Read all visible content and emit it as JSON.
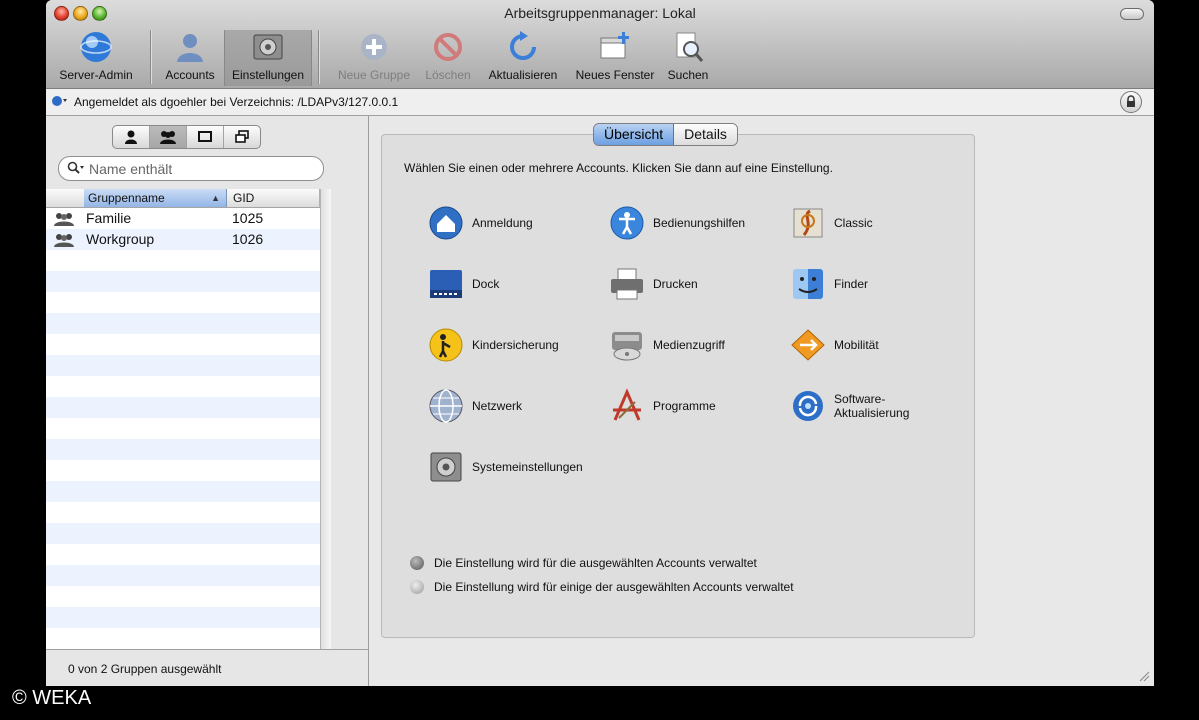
{
  "window": {
    "title": "Arbeitsgruppenmanager: Lokal"
  },
  "toolbar": {
    "server_admin": "Server-Admin",
    "accounts": "Accounts",
    "einstellungen": "Einstellungen",
    "neue_gruppe": "Neue Gruppe",
    "loeschen": "Löschen",
    "aktualisieren": "Aktualisieren",
    "neues_fenster": "Neues Fenster",
    "suchen": "Suchen"
  },
  "status": {
    "text": "Angemeldet als dgoehler bei Verzeichnis: /LDAPv3/127.0.0.1"
  },
  "left": {
    "search_placeholder": "Name enthält",
    "columns": {
      "name": "Gruppenname",
      "gid": "GID"
    },
    "rows": [
      {
        "name": "Familie",
        "gid": "1025"
      },
      {
        "name": "Workgroup",
        "gid": "1026"
      }
    ],
    "footer": "0 von 2 Gruppen ausgewählt"
  },
  "right": {
    "tabs": {
      "overview": "Übersicht",
      "details": "Details"
    },
    "instruction": "Wählen Sie einen oder mehrere Accounts. Klicken Sie dann auf eine Einstellung.",
    "settings": {
      "anmeldung": "Anmeldung",
      "bedienungshilfen": "Bedienungshilfen",
      "classic": "Classic",
      "dock": "Dock",
      "drucken": "Drucken",
      "finder": "Finder",
      "kindersicherung": "Kindersicherung",
      "medienzugriff": "Medienzugriff",
      "mobilitaet": "Mobilität",
      "netzwerk": "Netzwerk",
      "programme": "Programme",
      "software_1": "Software-",
      "software_2": "Aktualisierung",
      "systemeinstellungen": "Systemeinstellungen"
    },
    "legend": {
      "managed_all": "Die Einstellung wird für die ausgewählten Accounts verwaltet",
      "managed_some": "Die Einstellung wird für einige der ausgewählten Accounts verwaltet"
    }
  },
  "watermark": "© WEKA"
}
